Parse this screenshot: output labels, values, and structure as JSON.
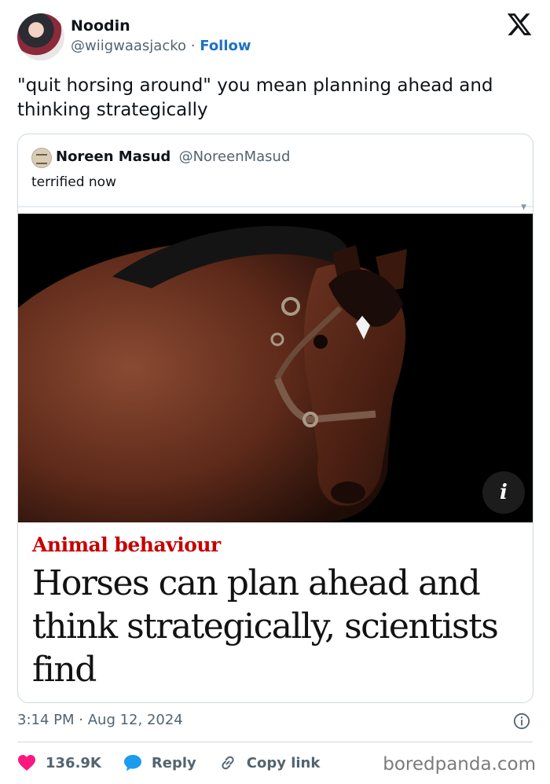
{
  "author": {
    "name": "Noodin",
    "handle": "@wiigwaasjacko",
    "separator": "·",
    "follow_label": "Follow"
  },
  "tweet": {
    "text": "\"quit horsing around\" you mean planning ahead and thinking strategically"
  },
  "quoted": {
    "name": "Noreen Masud",
    "handle": "@NoreenMasud",
    "text": "terrified now",
    "article": {
      "kicker": "Animal behaviour",
      "headline": "Horses can plan ahead and think strategically, scientists find",
      "info_glyph": "i"
    }
  },
  "meta": {
    "time": "3:14 PM",
    "separator": "·",
    "date": "Aug 12, 2024"
  },
  "actions": {
    "likes": "136.9K",
    "reply_label": "Reply",
    "copy_label": "Copy link"
  },
  "watermark": "boredpanda.com",
  "icons": {
    "platform": "x-logo-icon",
    "like": "heart-icon",
    "reply": "speech-bubble-icon",
    "copy": "link-icon",
    "info": "info-circle-icon"
  },
  "colors": {
    "accent": "#1d72c4",
    "like": "#f91880",
    "reply": "#1d9bf0",
    "kicker": "#c70000"
  }
}
